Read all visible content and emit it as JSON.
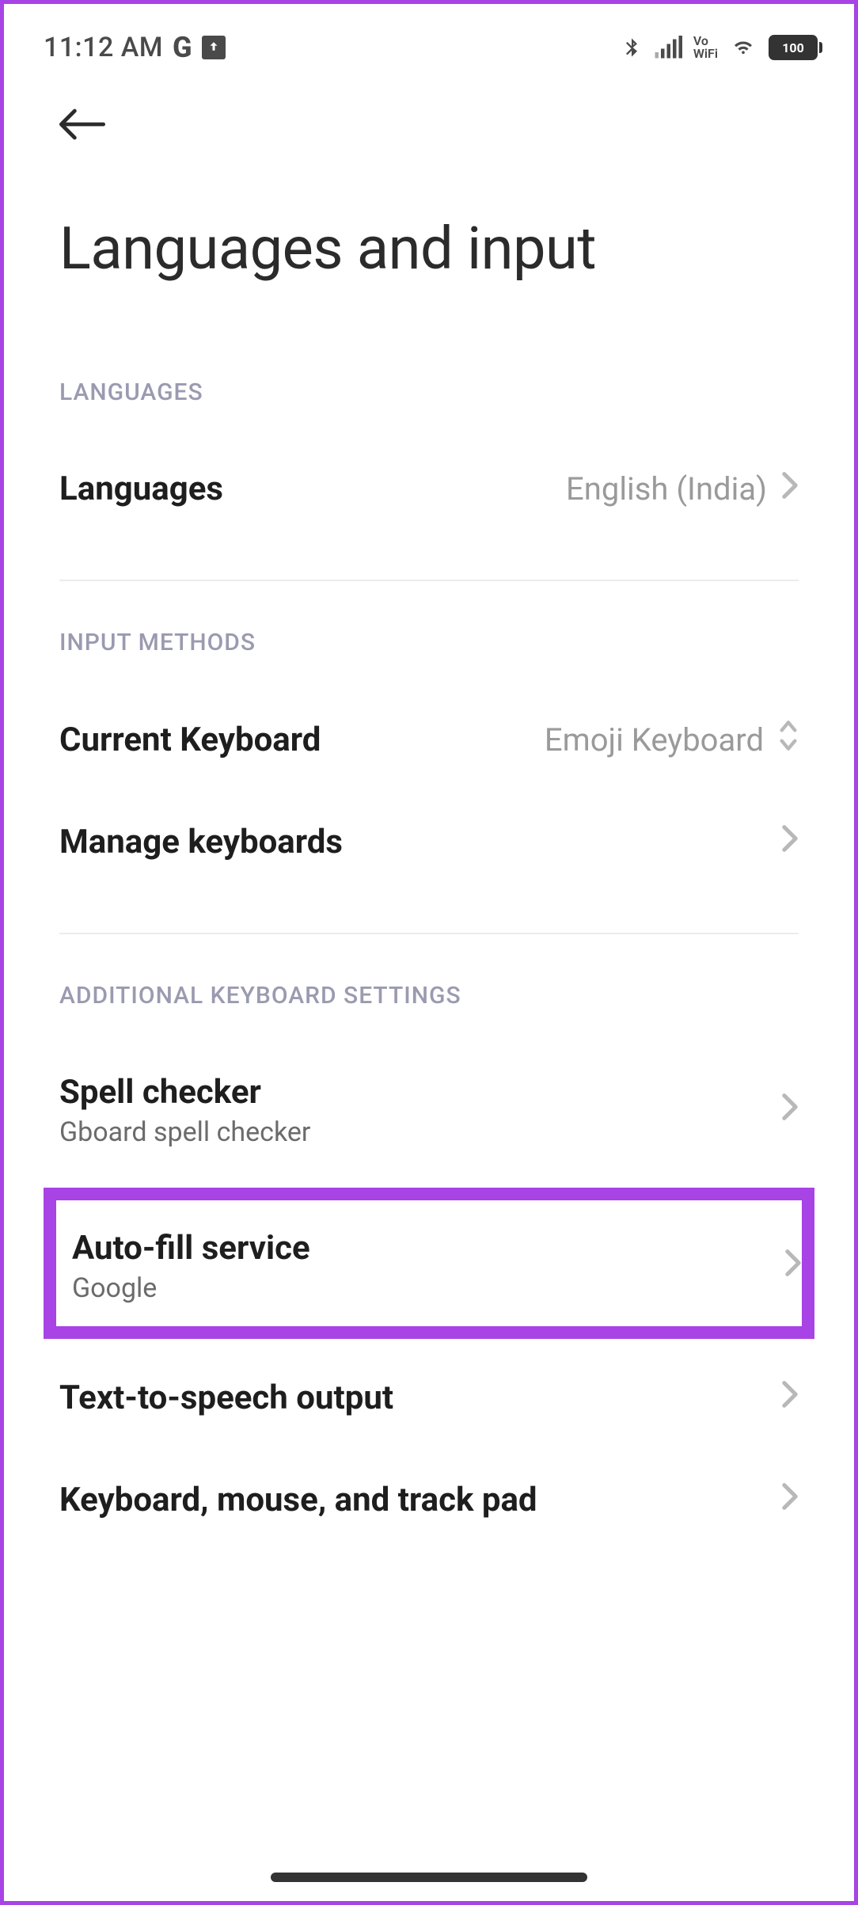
{
  "status_bar": {
    "time": "11:12 AM",
    "battery_level": "100"
  },
  "page": {
    "title": "Languages and input"
  },
  "sections": {
    "languages": {
      "header": "LANGUAGES",
      "languages_row": {
        "label": "Languages",
        "value": "English (India)"
      }
    },
    "input_methods": {
      "header": "INPUT METHODS",
      "current_keyboard": {
        "label": "Current Keyboard",
        "value": "Emoji Keyboard"
      },
      "manage_keyboards": {
        "label": "Manage keyboards"
      }
    },
    "additional": {
      "header": "ADDITIONAL KEYBOARD SETTINGS",
      "spell_checker": {
        "label": "Spell checker",
        "sublabel": "Gboard spell checker"
      },
      "autofill": {
        "label": "Auto-fill service",
        "sublabel": "Google"
      },
      "tts": {
        "label": "Text-to-speech output"
      },
      "kbm": {
        "label": "Keyboard, mouse, and track pad"
      }
    }
  }
}
